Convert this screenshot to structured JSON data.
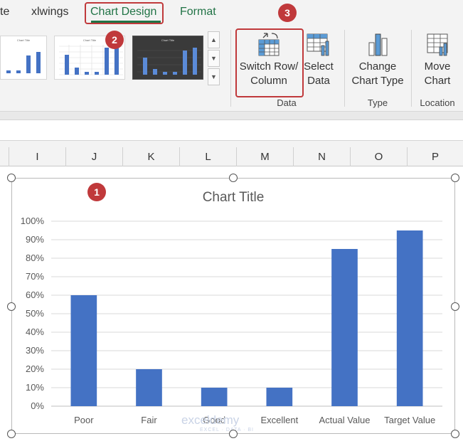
{
  "tabs": [
    {
      "label": "te"
    },
    {
      "label": "xlwings"
    },
    {
      "label": "Chart Design",
      "active": true
    },
    {
      "label": "Format"
    }
  ],
  "ribbon": {
    "gallery": [
      {
        "thumb_title": "Chart Title",
        "style": "light"
      },
      {
        "thumb_title": "Chart Title",
        "style": "grid"
      },
      {
        "thumb_title": "Chart Title",
        "style": "dark"
      }
    ],
    "switch_row_column": {
      "line1": "Switch Row/",
      "line2": "Column"
    },
    "select_data": {
      "line1": "Select",
      "line2": "Data"
    },
    "change_chart_type": {
      "line1": "Change",
      "line2": "Chart Type"
    },
    "move_chart": {
      "line1": "Move",
      "line2": "Chart"
    },
    "groups": {
      "data": "Data",
      "type": "Type",
      "location": "Location"
    }
  },
  "columns": [
    "I",
    "J",
    "K",
    "L",
    "M",
    "N",
    "O",
    "P"
  ],
  "badges": {
    "b1": "1",
    "b2": "2",
    "b3": "3"
  },
  "colors": {
    "accent": "#217346",
    "bar": "#4472c4",
    "badge": "#c0393b"
  },
  "watermark": {
    "main": "exceldemy",
    "sub": "EXCEL · DATA · BI"
  },
  "chart_data": {
    "type": "bar",
    "title": "Chart Title",
    "categories": [
      "Poor",
      "Fair",
      "Good",
      "Excellent",
      "Actual Value",
      "Target Value"
    ],
    "values": [
      0.6,
      0.2,
      0.1,
      0.1,
      0.85,
      0.95
    ],
    "ylim": [
      0,
      1
    ],
    "yticks": [
      "0%",
      "10%",
      "20%",
      "30%",
      "40%",
      "50%",
      "60%",
      "70%",
      "80%",
      "90%",
      "100%"
    ],
    "grid": true,
    "legend": "none"
  }
}
